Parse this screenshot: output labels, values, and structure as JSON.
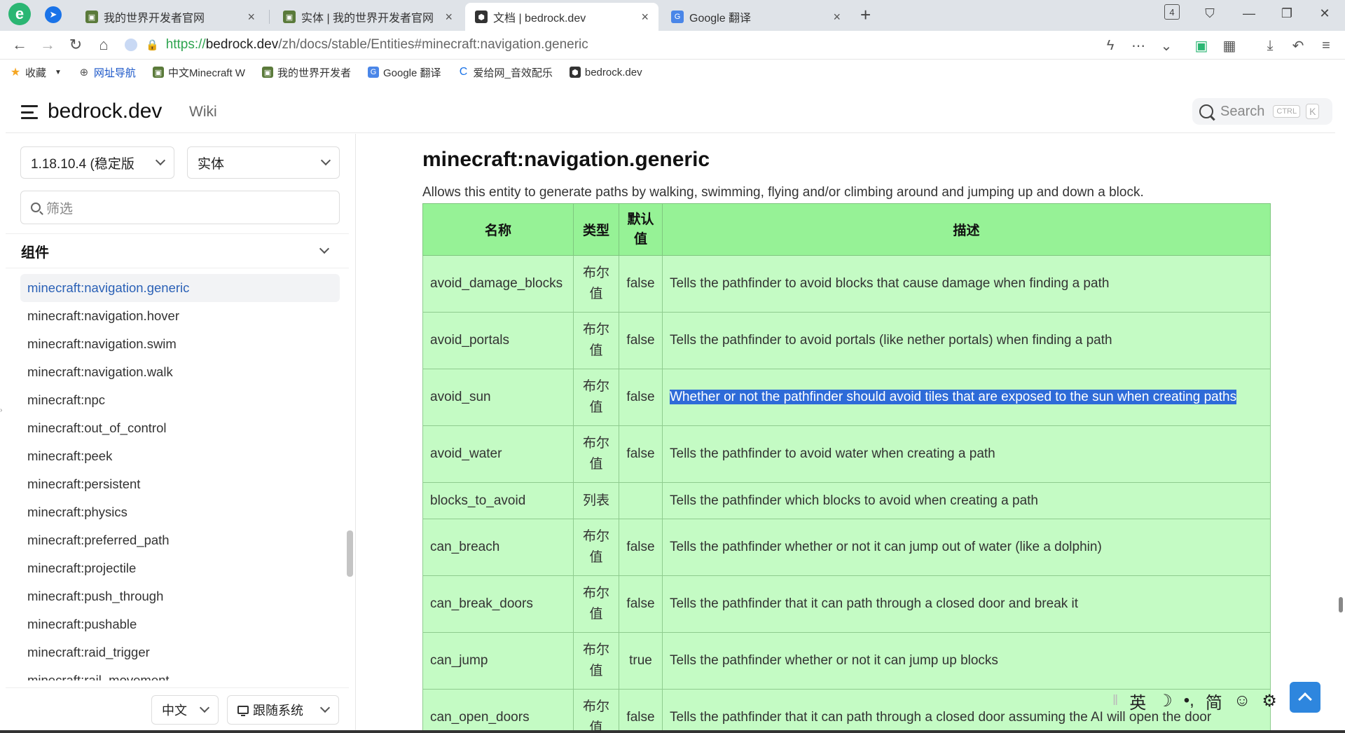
{
  "browser": {
    "logo": "e",
    "tabs": [
      {
        "title": "我的世界开发者官网",
        "active": false
      },
      {
        "title": "实体 | 我的世界开发者官网",
        "active": false
      },
      {
        "title": "文档 | bedrock.dev",
        "active": true
      },
      {
        "title": "Google 翻译",
        "active": false
      }
    ],
    "new_tab": "+",
    "tab_count": "4",
    "url": {
      "scheme": "https://",
      "host": "bedrock.dev",
      "path": "/zh/docs/stable/Entities#minecraft:navigation.generic"
    },
    "bookmarks": [
      "收藏",
      "网址导航",
      "中文Minecraft W",
      "我的世界开发者",
      "Google 翻译",
      "爱给网_音效配乐",
      "bedrock.dev"
    ]
  },
  "site": {
    "name": "bedrock.dev",
    "wiki": "Wiki",
    "search_label": "Search",
    "search_kbd_1": "CTRL",
    "search_kbd_2": "K"
  },
  "sidebar": {
    "version": "1.18.10.4 (稳定版",
    "category": "实体",
    "filter_placeholder": "筛选",
    "group": "组件",
    "items": [
      "minecraft:navigation.generic",
      "minecraft:navigation.hover",
      "minecraft:navigation.swim",
      "minecraft:navigation.walk",
      "minecraft:npc",
      "minecraft:out_of_control",
      "minecraft:peek",
      "minecraft:persistent",
      "minecraft:physics",
      "minecraft:preferred_path",
      "minecraft:projectile",
      "minecraft:push_through",
      "minecraft:pushable",
      "minecraft:raid_trigger",
      "minecraft:rail_movement"
    ],
    "active_index": 0,
    "language": "中文",
    "theme": "跟随系统"
  },
  "main": {
    "heading": "minecraft:navigation.generic",
    "description": "Allows this entity to generate paths by walking, swimming, flying and/or climbing around and jumping up and down a block.",
    "table": {
      "headers": [
        "名称",
        "类型",
        "默认值",
        "描述"
      ],
      "header_default_line1": "默认",
      "header_default_line2": "值",
      "rows": [
        {
          "name": "avoid_damage_blocks",
          "type1": "布尔",
          "type2": "值",
          "default": "false",
          "desc": "Tells the pathfinder to avoid blocks that cause damage when finding a path"
        },
        {
          "name": "avoid_portals",
          "type1": "布尔",
          "type2": "值",
          "default": "false",
          "desc": "Tells the pathfinder to avoid portals (like nether portals) when finding a path"
        },
        {
          "name": "avoid_sun",
          "type1": "布尔",
          "type2": "值",
          "default": "false",
          "desc": "Whether or not the pathfinder should avoid tiles that are exposed to the sun when creating paths"
        },
        {
          "name": "avoid_water",
          "type1": "布尔",
          "type2": "值",
          "default": "false",
          "desc": "Tells the pathfinder to avoid water when creating a path"
        },
        {
          "name": "blocks_to_avoid",
          "type1": "列表",
          "type2": "",
          "default": "",
          "desc": "Tells the pathfinder which blocks to avoid when creating a path"
        },
        {
          "name": "can_breach",
          "type1": "布尔",
          "type2": "值",
          "default": "false",
          "desc": "Tells the pathfinder whether or not it can jump out of water (like a dolphin)"
        },
        {
          "name": "can_break_doors",
          "type1": "布尔",
          "type2": "值",
          "default": "false",
          "desc": "Tells the pathfinder that it can path through a closed door and break it"
        },
        {
          "name": "can_jump",
          "type1": "布尔",
          "type2": "值",
          "default": "true",
          "desc": "Tells the pathfinder whether or not it can jump up blocks"
        },
        {
          "name": "can_open_doors",
          "type1": "布尔",
          "type2": "值",
          "default": "false",
          "desc": "Tells the pathfinder that it can path through a closed door assuming the AI will open the door"
        }
      ]
    }
  },
  "ime": {
    "lang": "英",
    "moon": "☽",
    "punct": "•,",
    "simp": "简",
    "emoji": "☺",
    "gear": "⚙"
  },
  "colors": {
    "table_bg": "#c4fbc4",
    "table_header": "#96f296",
    "selection": "#2e6bd8",
    "link_active": "#2b61b6"
  }
}
